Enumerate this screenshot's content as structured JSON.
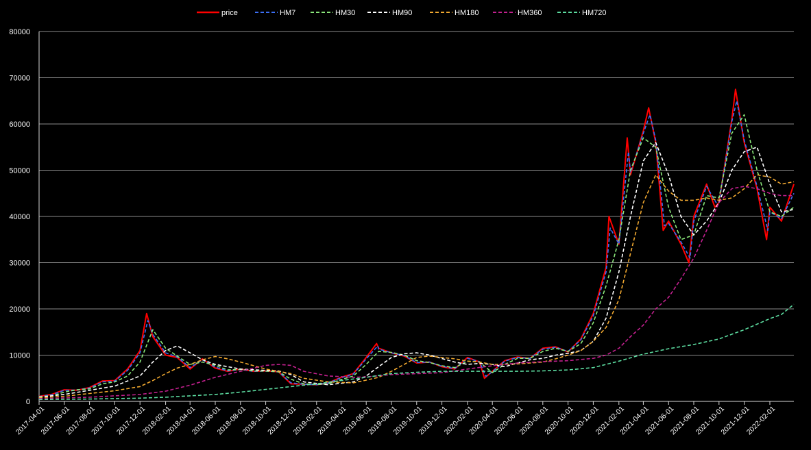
{
  "chart_data": {
    "type": "line",
    "title": "",
    "xlabel": "",
    "ylabel": "",
    "ylim": [
      0,
      80000
    ],
    "yticks": [
      0,
      10000,
      20000,
      30000,
      40000,
      50000,
      60000,
      70000,
      80000
    ],
    "xlim": [
      "2017-04-01",
      "2022-03-31"
    ],
    "xticks": [
      "2017-04-01",
      "2017-06-01",
      "2017-08-01",
      "2017-10-01",
      "2017-12-01",
      "2018-02-01",
      "2018-04-01",
      "2018-06-01",
      "2018-08-01",
      "2018-10-01",
      "2018-12-01",
      "2019-02-01",
      "2019-04-01",
      "2019-06-01",
      "2019-08-01",
      "2019-10-01",
      "2019-12-01",
      "2020-02-01",
      "2020-04-01",
      "2020-06-01",
      "2020-08-01",
      "2020-10-01",
      "2020-12-01",
      "2021-02-01",
      "2021-04-01",
      "2021-06-01",
      "2021-08-01",
      "2021-10-01",
      "2021-12-01",
      "2022-02-01"
    ],
    "grid": "horizontal",
    "legend_position": "top-center",
    "series": [
      {
        "name": "price",
        "color": "#ff0000",
        "dash": "solid",
        "x": [
          "2017-04-01",
          "2017-05-01",
          "2017-06-01",
          "2017-07-01",
          "2017-08-01",
          "2017-09-01",
          "2017-10-01",
          "2017-11-01",
          "2017-12-01",
          "2017-12-17",
          "2018-01-01",
          "2018-02-01",
          "2018-03-01",
          "2018-04-01",
          "2018-05-01",
          "2018-06-01",
          "2018-07-01",
          "2018-08-01",
          "2018-09-01",
          "2018-10-01",
          "2018-11-01",
          "2018-12-01",
          "2019-01-01",
          "2019-02-01",
          "2019-03-01",
          "2019-04-01",
          "2019-05-01",
          "2019-06-01",
          "2019-06-26",
          "2019-07-01",
          "2019-08-01",
          "2019-09-01",
          "2019-10-01",
          "2019-11-01",
          "2019-12-01",
          "2020-01-01",
          "2020-02-01",
          "2020-03-01",
          "2020-03-13",
          "2020-04-01",
          "2020-05-01",
          "2020-06-01",
          "2020-07-01",
          "2020-08-01",
          "2020-09-01",
          "2020-10-01",
          "2020-11-01",
          "2020-12-01",
          "2021-01-01",
          "2021-01-08",
          "2021-02-01",
          "2021-02-21",
          "2021-03-01",
          "2021-04-01",
          "2021-04-14",
          "2021-05-01",
          "2021-05-19",
          "2021-06-01",
          "2021-07-01",
          "2021-07-20",
          "2021-08-01",
          "2021-09-01",
          "2021-09-21",
          "2021-10-01",
          "2021-11-01",
          "2021-11-10",
          "2021-12-01",
          "2022-01-01",
          "2022-01-24",
          "2022-02-01",
          "2022-03-01",
          "2022-03-31"
        ],
        "values": [
          1100,
          1500,
          2500,
          2400,
          3000,
          4400,
          4500,
          7000,
          11000,
          19000,
          14000,
          10000,
          9500,
          7000,
          9200,
          7200,
          6500,
          7000,
          6500,
          6600,
          6400,
          3800,
          3700,
          3600,
          4000,
          5200,
          6000,
          9500,
          12500,
          11500,
          10500,
          9800,
          8300,
          8500,
          7500,
          7000,
          9500,
          8500,
          5000,
          6500,
          8800,
          9600,
          9300,
          11500,
          11800,
          10700,
          13500,
          19000,
          29000,
          40000,
          34000,
          57000,
          49000,
          58500,
          63500,
          56000,
          37000,
          39000,
          34000,
          30000,
          40000,
          47000,
          42000,
          43000,
          61000,
          67500,
          56000,
          46000,
          35000,
          42000,
          39000,
          47000
        ]
      },
      {
        "name": "HM7",
        "color": "#3b6ff5",
        "dash": "dashed",
        "x": [
          "2017-04-01",
          "2017-05-01",
          "2017-06-01",
          "2017-07-01",
          "2017-08-01",
          "2017-09-01",
          "2017-10-01",
          "2017-11-01",
          "2017-12-01",
          "2017-12-20",
          "2018-01-01",
          "2018-02-01",
          "2018-03-01",
          "2018-04-01",
          "2018-05-01",
          "2018-06-01",
          "2018-07-01",
          "2018-08-01",
          "2018-09-01",
          "2018-10-01",
          "2018-11-01",
          "2018-12-01",
          "2019-01-01",
          "2019-02-01",
          "2019-03-01",
          "2019-04-01",
          "2019-05-01",
          "2019-06-01",
          "2019-06-29",
          "2019-07-01",
          "2019-08-01",
          "2019-09-01",
          "2019-10-01",
          "2019-11-01",
          "2019-12-01",
          "2020-01-01",
          "2020-02-01",
          "2020-03-01",
          "2020-03-16",
          "2020-04-01",
          "2020-05-01",
          "2020-06-01",
          "2020-07-01",
          "2020-08-01",
          "2020-09-01",
          "2020-10-01",
          "2020-11-01",
          "2020-12-01",
          "2021-01-01",
          "2021-01-11",
          "2021-02-01",
          "2021-02-24",
          "2021-03-01",
          "2021-04-01",
          "2021-04-17",
          "2021-05-01",
          "2021-05-22",
          "2021-06-01",
          "2021-07-01",
          "2021-07-23",
          "2021-08-01",
          "2021-09-01",
          "2021-09-24",
          "2021-10-01",
          "2021-11-01",
          "2021-11-13",
          "2021-12-01",
          "2022-01-01",
          "2022-01-27",
          "2022-02-01",
          "2022-03-01",
          "2022-03-31"
        ],
        "values": [
          1050,
          1400,
          2400,
          2450,
          2900,
          4200,
          4400,
          6700,
          10500,
          17500,
          14500,
          10500,
          9600,
          7300,
          9000,
          7400,
          6600,
          6900,
          6500,
          6550,
          6400,
          4000,
          3700,
          3600,
          3950,
          5100,
          5900,
          9200,
          12000,
          11300,
          10500,
          9900,
          8400,
          8500,
          7600,
          7100,
          9300,
          8600,
          5400,
          6400,
          8700,
          9500,
          9300,
          11300,
          11700,
          10800,
          13300,
          18500,
          28000,
          37500,
          34000,
          54000,
          49500,
          58000,
          62000,
          56500,
          38000,
          38500,
          34500,
          31000,
          39000,
          46500,
          43000,
          43000,
          60500,
          65000,
          56500,
          46500,
          37000,
          41000,
          39500,
          45000
        ]
      },
      {
        "name": "HM30",
        "color": "#8ae67a",
        "dash": "dashed",
        "x": [
          "2017-04-01",
          "2017-05-01",
          "2017-06-01",
          "2017-07-01",
          "2017-08-01",
          "2017-09-01",
          "2017-10-01",
          "2017-11-01",
          "2017-12-01",
          "2018-01-01",
          "2018-02-01",
          "2018-03-01",
          "2018-04-01",
          "2018-05-01",
          "2018-06-01",
          "2018-07-01",
          "2018-08-01",
          "2018-09-01",
          "2018-10-01",
          "2018-11-01",
          "2018-12-01",
          "2019-01-01",
          "2019-02-01",
          "2019-03-01",
          "2019-04-01",
          "2019-05-01",
          "2019-06-01",
          "2019-07-01",
          "2019-08-01",
          "2019-09-01",
          "2019-10-01",
          "2019-11-01",
          "2019-12-01",
          "2020-01-01",
          "2020-02-01",
          "2020-03-01",
          "2020-04-01",
          "2020-05-01",
          "2020-06-01",
          "2020-07-01",
          "2020-08-01",
          "2020-09-01",
          "2020-10-01",
          "2020-11-01",
          "2020-12-01",
          "2021-01-01",
          "2021-02-01",
          "2021-03-01",
          "2021-04-01",
          "2021-05-01",
          "2021-06-01",
          "2021-07-01",
          "2021-08-01",
          "2021-09-01",
          "2021-10-01",
          "2021-11-01",
          "2021-12-01",
          "2022-01-01",
          "2022-02-01",
          "2022-03-01",
          "2022-03-31"
        ],
        "values": [
          1000,
          1200,
          2000,
          2500,
          2700,
          3800,
          4200,
          5500,
          8500,
          15500,
          11500,
          9800,
          8000,
          8500,
          7800,
          6800,
          6900,
          6600,
          6550,
          6400,
          4800,
          3800,
          3650,
          3800,
          4700,
          5500,
          8000,
          10800,
          10600,
          10000,
          8800,
          8400,
          7700,
          7300,
          8700,
          8500,
          6200,
          8000,
          9300,
          9300,
          10800,
          11500,
          10800,
          12500,
          17000,
          25000,
          35000,
          50000,
          57000,
          55000,
          42000,
          35000,
          36000,
          44500,
          44000,
          58000,
          62000,
          50000,
          41000,
          40000,
          42000
        ]
      },
      {
        "name": "HM90",
        "color": "#ffffff",
        "dash": "dashed",
        "x": [
          "2017-04-01",
          "2017-06-01",
          "2017-08-01",
          "2017-10-01",
          "2017-12-01",
          "2018-01-01",
          "2018-02-01",
          "2018-03-01",
          "2018-04-01",
          "2018-05-01",
          "2018-06-01",
          "2018-08-01",
          "2018-10-01",
          "2018-11-01",
          "2018-12-01",
          "2019-01-01",
          "2019-03-01",
          "2019-05-01",
          "2019-06-01",
          "2019-07-01",
          "2019-08-01",
          "2019-09-01",
          "2019-10-01",
          "2019-11-01",
          "2020-01-01",
          "2020-02-01",
          "2020-03-01",
          "2020-04-01",
          "2020-05-01",
          "2020-06-01",
          "2020-07-01",
          "2020-08-01",
          "2020-09-01",
          "2020-10-01",
          "2020-11-01",
          "2020-12-01",
          "2021-01-01",
          "2021-02-01",
          "2021-03-01",
          "2021-04-01",
          "2021-05-01",
          "2021-06-01",
          "2021-07-01",
          "2021-08-01",
          "2021-09-01",
          "2021-10-01",
          "2021-11-01",
          "2021-12-01",
          "2022-01-01",
          "2022-02-01",
          "2022-03-01",
          "2022-03-31"
        ],
        "values": [
          900,
          1500,
          2400,
          3300,
          5500,
          8500,
          11000,
          12000,
          10500,
          9000,
          8000,
          7000,
          6700,
          6600,
          5800,
          4200,
          3600,
          4200,
          5500,
          7500,
          9500,
          10300,
          10500,
          10000,
          8500,
          8000,
          8200,
          8000,
          7500,
          8300,
          9000,
          9300,
          10000,
          10400,
          11000,
          13000,
          18000,
          28000,
          40000,
          52000,
          56000,
          49000,
          40000,
          36000,
          39000,
          43000,
          50000,
          54000,
          55000,
          47000,
          41000,
          41500
        ]
      },
      {
        "name": "HM180",
        "color": "#f0a830",
        "dash": "dashed",
        "x": [
          "2017-04-01",
          "2017-06-01",
          "2017-08-01",
          "2017-10-01",
          "2017-12-01",
          "2018-01-01",
          "2018-02-01",
          "2018-03-01",
          "2018-04-01",
          "2018-05-01",
          "2018-06-01",
          "2018-07-01",
          "2018-08-01",
          "2018-10-01",
          "2018-11-01",
          "2018-12-01",
          "2019-01-01",
          "2019-03-01",
          "2019-05-01",
          "2019-06-01",
          "2019-07-01",
          "2019-08-01",
          "2019-09-01",
          "2019-10-01",
          "2019-11-01",
          "2020-01-01",
          "2020-02-01",
          "2020-03-01",
          "2020-04-01",
          "2020-05-01",
          "2020-06-01",
          "2020-07-01",
          "2020-08-01",
          "2020-09-01",
          "2020-10-01",
          "2020-11-01",
          "2020-12-01",
          "2021-01-01",
          "2021-02-01",
          "2021-03-01",
          "2021-04-01",
          "2021-05-01",
          "2021-06-01",
          "2021-07-01",
          "2021-08-01",
          "2021-09-01",
          "2021-10-01",
          "2021-11-01",
          "2021-12-01",
          "2022-01-01",
          "2022-02-01",
          "2022-03-01",
          "2022-03-31"
        ],
        "values": [
          800,
          1100,
          1700,
          2300,
          3200,
          4500,
          6000,
          7200,
          8000,
          9000,
          9700,
          9200,
          8500,
          7000,
          6500,
          6000,
          5000,
          4200,
          4000,
          4600,
          5200,
          6500,
          8000,
          9500,
          9800,
          9200,
          8700,
          8500,
          8000,
          8000,
          8100,
          8300,
          8500,
          9200,
          10000,
          11000,
          13000,
          16000,
          22000,
          32000,
          43000,
          49000,
          45500,
          43500,
          43500,
          44000,
          43500,
          44000,
          46000,
          49000,
          48500,
          47000,
          47500
        ]
      },
      {
        "name": "HM360",
        "color": "#c2208e",
        "dash": "dashed",
        "x": [
          "2017-04-01",
          "2017-08-01",
          "2017-12-01",
          "2018-02-01",
          "2018-04-01",
          "2018-06-01",
          "2018-08-01",
          "2018-10-01",
          "2018-11-01",
          "2018-12-01",
          "2019-01-01",
          "2019-03-01",
          "2019-05-01",
          "2019-06-01",
          "2019-08-01",
          "2019-10-01",
          "2019-12-01",
          "2020-02-01",
          "2020-04-01",
          "2020-06-01",
          "2020-08-01",
          "2020-10-01",
          "2020-12-01",
          "2021-01-01",
          "2021-02-01",
          "2021-03-01",
          "2021-04-01",
          "2021-05-01",
          "2021-06-01",
          "2021-07-01",
          "2021-08-01",
          "2021-09-01",
          "2021-10-01",
          "2021-11-01",
          "2021-12-01",
          "2022-01-01",
          "2022-02-01",
          "2022-03-01",
          "2022-03-31"
        ],
        "values": [
          600,
          900,
          1500,
          2200,
          3500,
          5200,
          6500,
          7800,
          8000,
          7800,
          6500,
          5500,
          5200,
          5300,
          5800,
          6000,
          6200,
          7000,
          7700,
          8300,
          8600,
          8800,
          9300,
          10000,
          11500,
          14000,
          16500,
          20000,
          22500,
          26500,
          31000,
          37000,
          43000,
          46000,
          46500,
          46000,
          45000,
          44500,
          44500
        ]
      },
      {
        "name": "HM720",
        "color": "#5cdca0",
        "dash": "dashed",
        "x": [
          "2017-04-01",
          "2017-08-01",
          "2017-12-01",
          "2018-02-01",
          "2018-04-01",
          "2018-06-01",
          "2018-08-01",
          "2018-10-01",
          "2018-12-01",
          "2019-02-01",
          "2019-04-01",
          "2019-06-01",
          "2019-08-01",
          "2019-10-01",
          "2019-12-01",
          "2020-02-01",
          "2020-04-01",
          "2020-06-01",
          "2020-08-01",
          "2020-10-01",
          "2020-12-01",
          "2021-02-01",
          "2021-04-01",
          "2021-06-01",
          "2021-08-01",
          "2021-10-01",
          "2021-12-01",
          "2022-02-01",
          "2022-03-01",
          "2022-03-31"
        ],
        "values": [
          400,
          500,
          700,
          900,
          1200,
          1500,
          2000,
          2600,
          3200,
          3800,
          4500,
          5200,
          6000,
          6300,
          6500,
          6500,
          6500,
          6500,
          6600,
          6800,
          7300,
          8700,
          10200,
          11400,
          12300,
          13500,
          15500,
          17900,
          18800,
          21000
        ]
      }
    ]
  }
}
